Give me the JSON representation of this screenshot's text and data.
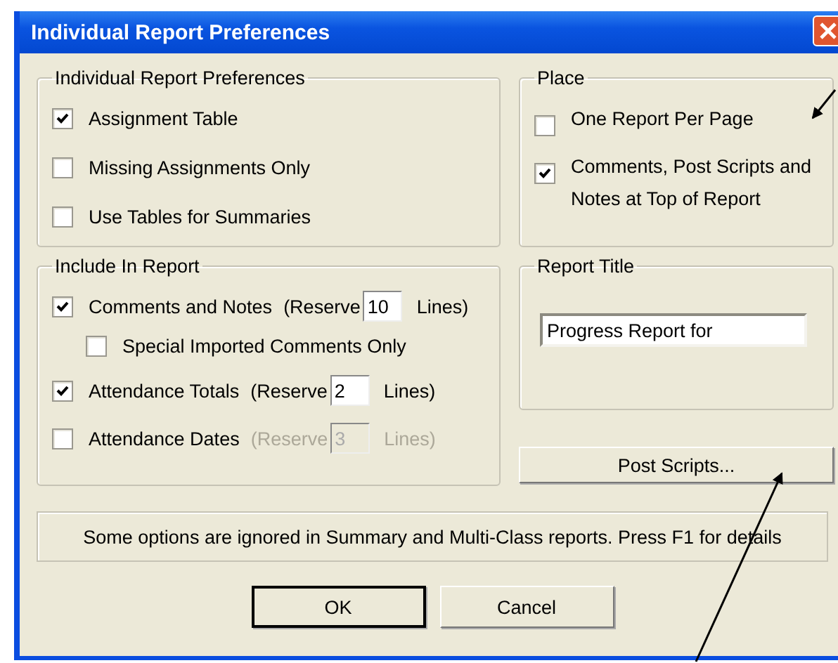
{
  "window": {
    "title": "Individual Report Preferences"
  },
  "preferences": {
    "title": "Individual Report Preferences",
    "items": [
      {
        "label": "Assignment Table",
        "checked": true
      },
      {
        "label": "Missing Assignments Only",
        "checked": false
      },
      {
        "label": "Use Tables for Summaries",
        "checked": false
      }
    ]
  },
  "place": {
    "title": "Place",
    "items": [
      {
        "label": "One Report Per Page",
        "checked": false
      },
      {
        "label": "Comments, Post Scripts and Notes at Top of Report",
        "checked": true
      }
    ]
  },
  "include": {
    "title": "Include In Report",
    "items": [
      {
        "label": "Comments and Notes",
        "checked": true,
        "disabled": false,
        "reserve_label": "(Reserve",
        "reserve_value": "10",
        "reserve_unit": "Lines)",
        "children": [
          {
            "label": "Special Imported Comments Only",
            "checked": false
          }
        ]
      },
      {
        "label": "Attendance Totals",
        "checked": true,
        "disabled": false,
        "reserve_label": "(Reserve",
        "reserve_value": "2",
        "reserve_unit": "Lines)"
      },
      {
        "label": "Attendance Dates",
        "checked": false,
        "disabled": true,
        "reserve_label": "(Reserve",
        "reserve_value": "3",
        "reserve_unit": "Lines)"
      }
    ]
  },
  "report_title": {
    "title": "Report Title",
    "value": "Progress Report for"
  },
  "post_scripts_button": "Post Scripts...",
  "note": "Some options are ignored in Summary and Multi-Class reports. Press F1 for details",
  "buttons": [
    {
      "label": "OK",
      "default": true
    },
    {
      "label": "Cancel",
      "default": false
    }
  ]
}
